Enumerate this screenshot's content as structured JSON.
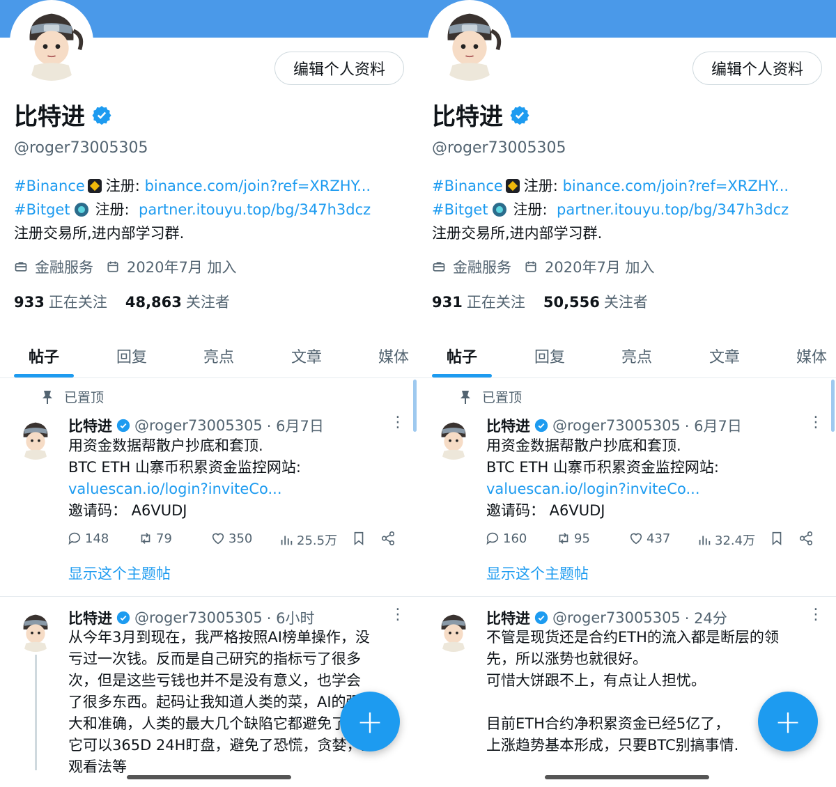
{
  "colors": {
    "accent": "#1d9bf0",
    "banner": "#4a99e9",
    "muted": "#536471"
  },
  "panels": [
    {
      "edit_profile": "编辑个人资料",
      "name": "比特进",
      "handle": "@roger73005305",
      "bio": {
        "l1_tag": "#Binance",
        "l1_label": "注册:",
        "l1_link": "binance.com/join?ref=XRZHY...",
        "l2_tag": "#Bitget",
        "l2_label": "注册:",
        "l2_link": "partner.itouyu.top/bg/347h3dcz",
        "l3": "注册交易所,进内部学习群."
      },
      "category": "金融服务",
      "joined": "2020年7月 加入",
      "following_count": "933",
      "following_label": "正在关注",
      "followers_count": "48,863",
      "followers_label": "关注者",
      "tabs": [
        "帖子",
        "回复",
        "亮点",
        "文章",
        "媒体"
      ],
      "pinned_label": "已置顶",
      "pinned_post": {
        "name": "比特进",
        "handle": "@roger73005305",
        "time": "· 6月7日",
        "line1": "用资金数据帮散户抄底和套顶.",
        "line2": "BTC ETH 山寨币积累资金监控网站:",
        "link": "valuescan.io/login?inviteCo...",
        "line4": "邀请码：  A6VUDJ",
        "replies": "148",
        "reposts": "79",
        "likes": "350",
        "views": "25.5万"
      },
      "show_thread": "显示这个主题帖",
      "post2": {
        "name": "比特进",
        "handle": "@roger73005305",
        "time": "· 6小时",
        "lines": [
          "从今年3月到现在，我严格按照AI榜单操作，没",
          "亏过一次钱。反而是自己研究的指标亏了很多",
          "次，但是这些亏钱也并不是没有意义，也学会",
          "了很多东西。起码让我知道人类的菜，AI的强",
          "大和准确，人类的最大几个缺陷它都避免了，",
          "它可以365D 24H盯盘，避免了恐慌，贪婪，主",
          "观看法等"
        ]
      }
    },
    {
      "edit_profile": "编辑个人资料",
      "name": "比特进",
      "handle": "@roger73005305",
      "bio": {
        "l1_tag": "#Binance",
        "l1_label": "注册:",
        "l1_link": "binance.com/join?ref=XRZHY...",
        "l2_tag": "#Bitget",
        "l2_label": "注册:",
        "l2_link": "partner.itouyu.top/bg/347h3dcz",
        "l3": "注册交易所,进内部学习群."
      },
      "category": "金融服务",
      "joined": "2020年7月 加入",
      "following_count": "931",
      "following_label": "正在关注",
      "followers_count": "50,556",
      "followers_label": "关注者",
      "tabs": [
        "帖子",
        "回复",
        "亮点",
        "文章",
        "媒体"
      ],
      "pinned_label": "已置顶",
      "pinned_post": {
        "name": "比特进",
        "handle": "@roger73005305",
        "time": "· 6月7日",
        "line1": "用资金数据帮散户抄底和套顶.",
        "line2": "BTC ETH 山寨币积累资金监控网站:",
        "link": "valuescan.io/login?inviteCo...",
        "line4": "邀请码：  A6VUDJ",
        "replies": "160",
        "reposts": "95",
        "likes": "437",
        "views": "32.4万"
      },
      "show_thread": "显示这个主题帖",
      "post2": {
        "name": "比特进",
        "handle": "@roger73005305",
        "time": "· 24分",
        "lines": [
          "不管是现货还是合约ETH的流入都是断层的领",
          "先，所以涨势也就很好。",
          "可惜大饼跟不上，有点让人担忧。",
          "",
          "目前ETH合约净积累资金已经5亿了，",
          "上涨趋势基本形成，只要BTC别搞事情."
        ]
      }
    }
  ],
  "fab_symbol": "+"
}
